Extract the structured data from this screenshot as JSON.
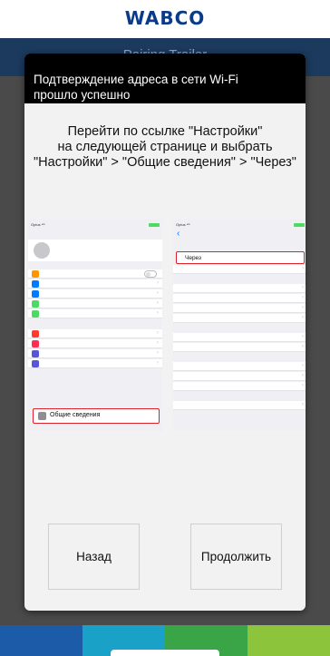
{
  "app": {
    "logo": "WABCO",
    "bar_title": "Pairing Trailer",
    "nav_colors": [
      "#1b5ba8",
      "#1aa1c8",
      "#3aa547",
      "#8cc43c"
    ]
  },
  "dialog": {
    "header": "Подтверждение адреса в сети Wi-Fi\nпрошло успешно",
    "instruction": "Перейти по ссылке \"Настройки\"\nна следующей странице и выбрать\n\"Настройки\" > \"Общие сведения\" > \"Через\"",
    "back_button": "Назад",
    "next_button": "Продолжить"
  },
  "mock_left": {
    "carrier": "Optus ⁴ᴳ",
    "highlight_label": "Общие сведения"
  },
  "mock_right": {
    "carrier": "Optus ⁴ᴳ",
    "highlight_label": "Через"
  },
  "colors": {
    "highlight": "#e0202a",
    "ios_blue": "#007aff"
  }
}
